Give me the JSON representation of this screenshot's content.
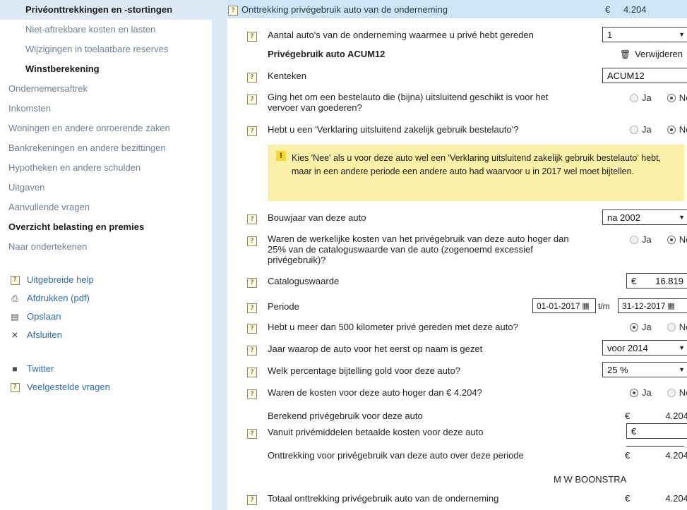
{
  "sidebar": {
    "nav_items": [
      {
        "label": "Privéonttrekkingen en -stortingen",
        "level": "sub",
        "state": "active"
      },
      {
        "label": "Niet-aftrekbare kosten en lasten",
        "level": "sub",
        "state": "normal"
      },
      {
        "label": "Wijzigingen in toelaatbare reserves",
        "level": "sub",
        "state": "normal"
      },
      {
        "label": "Winstberekening",
        "level": "sub",
        "state": "bold"
      },
      {
        "label": "Ondernemersaftrek",
        "level": "top",
        "state": "normal"
      },
      {
        "label": "Inkomsten",
        "level": "top",
        "state": "normal"
      },
      {
        "label": "Woningen en andere onroerende zaken",
        "level": "top",
        "state": "normal"
      },
      {
        "label": "Bankrekeningen en andere bezittingen",
        "level": "top",
        "state": "normal"
      },
      {
        "label": "Hypotheken en andere schulden",
        "level": "top",
        "state": "normal"
      },
      {
        "label": "Uitgaven",
        "level": "top",
        "state": "normal"
      },
      {
        "label": "Aanvullende vragen",
        "level": "top",
        "state": "normal"
      },
      {
        "label": "Overzicht belasting en premies",
        "level": "top",
        "state": "bold"
      },
      {
        "label": "Naar ondertekenen",
        "level": "top",
        "state": "normal"
      }
    ],
    "tools": [
      {
        "label": "Uitgebreide help",
        "icon": "question-mark-icon",
        "glyph": "?"
      },
      {
        "label": "Afdrukken (pdf)",
        "icon": "printer-icon",
        "glyph": "⎙"
      },
      {
        "label": "Opslaan",
        "icon": "floppy-disk-icon",
        "glyph": "▤"
      },
      {
        "label": "Afsluiten",
        "icon": "close-x-icon",
        "glyph": "✕"
      }
    ],
    "tools_secondary": [
      {
        "label": "Twitter",
        "icon": "twitter-icon",
        "glyph": "■"
      },
      {
        "label": "Veelgestelde vragen",
        "icon": "question-mark-icon",
        "glyph": "?"
      }
    ]
  },
  "section": {
    "caret": "▼",
    "title": "Onttrekking privégebruik auto van de onderneming",
    "currency": "€",
    "amount": "4.204"
  },
  "help_glyph": "?",
  "fields": {
    "aantal_autos": {
      "label": "Aantal auto's van de onderneming waarmee u privé hebt gereden",
      "value": "1",
      "arrow": "▼"
    },
    "car_heading": "Privégebruik auto ACUM12",
    "delete": {
      "label": "Verwijderen",
      "icon": "🗑"
    },
    "kenteken": {
      "label": "Kenteken",
      "value": "ACUM12"
    },
    "bestelauto": {
      "label": "Ging het om een bestelauto die (bijna) uitsluitend geschikt is voor het vervoer van goederen?",
      "yes": "Ja",
      "no": "Nee",
      "selected": "Nee"
    },
    "verklaring": {
      "label": "Hebt u een 'Verklaring uitsluitend zakelijk gebruik bestelauto'?",
      "yes": "Ja",
      "no": "Nee",
      "selected": "Nee"
    },
    "warning": {
      "icon": "!",
      "text": "Kies 'Nee' als u voor deze auto wel een 'Verklaring uitsluitend zakelijk gebruik bestelauto' hebt, maar in een andere periode een andere auto had waarvoor u in 2017 wel moet bijtellen."
    },
    "bouwjaar": {
      "label": "Bouwjaar van deze auto",
      "value": "na 2002",
      "arrow": "▼"
    },
    "excessief": {
      "label": "Waren de werkelijke kosten van het privégebruik van deze auto hoger dan 25% van de cataloguswaarde van de auto (zogenoemd excessief privégebruik)?",
      "yes": "Ja",
      "no": "Nee",
      "selected": "Nee"
    },
    "cataloguswaarde": {
      "label": "Cataloguswaarde",
      "currency": "€",
      "value": "16.819"
    },
    "periode": {
      "label": "Periode",
      "from": "01-01-2017",
      "separator": "t/m",
      "to": "31-12-2017",
      "calendar_icon": "▦"
    },
    "km500": {
      "label": "Hebt u meer dan 500 kilometer privé gereden met deze auto?",
      "yes": "Ja",
      "no": "Nee",
      "selected": "Ja"
    },
    "eerste_naam_jaar": {
      "label": "Jaar waarop de auto voor het eerst op naam is gezet",
      "value": "voor 2014",
      "arrow": "▼"
    },
    "bijtelling_pct": {
      "label": "Welk percentage bijtelling gold voor deze auto?",
      "value": "25 %",
      "arrow": "▼"
    },
    "kosten_hoger": {
      "label": "Waren de kosten voor deze auto hoger dan € 4.204?",
      "yes": "Ja",
      "no": "Nee",
      "selected": "Ja"
    },
    "berekend_privegebruik": {
      "label": "Berekend privégebruik voor deze auto",
      "currency": "€",
      "value": "4.204"
    },
    "privemiddelen_kosten": {
      "label": "Vanuit privémiddelen betaalde kosten voor deze auto",
      "currency": "€",
      "value": ""
    },
    "onttrekking_periode": {
      "label": "Onttrekking voor privégebruik van deze auto over deze periode",
      "currency": "€",
      "value": "4.204",
      "operator": "-"
    },
    "owner_name": "M W BOONSTRA",
    "totaal": {
      "label": "Totaal onttrekking privégebruik auto van de onderneming",
      "currency": "€",
      "value": "4.204"
    }
  },
  "colors": {
    "header_bar": "#cfe4f5",
    "blue_strip": "#dbeaf7",
    "active_nav": "#ddeaf6",
    "warning_bg": "#faf0a8",
    "warning_icon": "#f2d930",
    "help_icon_bg": "#fdfbe0",
    "link_text": "#2f6ca8"
  }
}
